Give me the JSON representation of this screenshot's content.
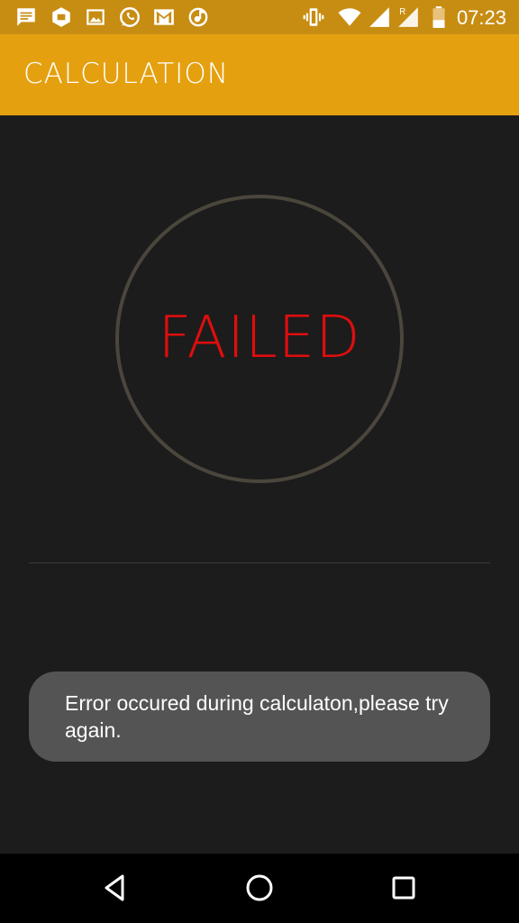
{
  "status_bar": {
    "time": "07:23",
    "left_icons": [
      "message-icon",
      "package-icon",
      "gallery-icon",
      "whatsapp-icon",
      "gmail-icon",
      "music-icon"
    ],
    "right_icons": [
      "vibrate-icon",
      "wifi-icon",
      "signal-icon",
      "roaming-signal-icon",
      "battery-icon"
    ],
    "roaming_label": "R",
    "background": "#c78d12"
  },
  "app_bar": {
    "title": "CALCULATION",
    "background": "#e5a010"
  },
  "result": {
    "status_text": "FAILED",
    "status_color": "#e00d0d",
    "ring_color": "#4b463c"
  },
  "toast": {
    "message": "Error occured during calculaton,please try again."
  },
  "nav_bar": {
    "buttons": [
      "back-icon",
      "home-icon",
      "recents-icon"
    ]
  }
}
